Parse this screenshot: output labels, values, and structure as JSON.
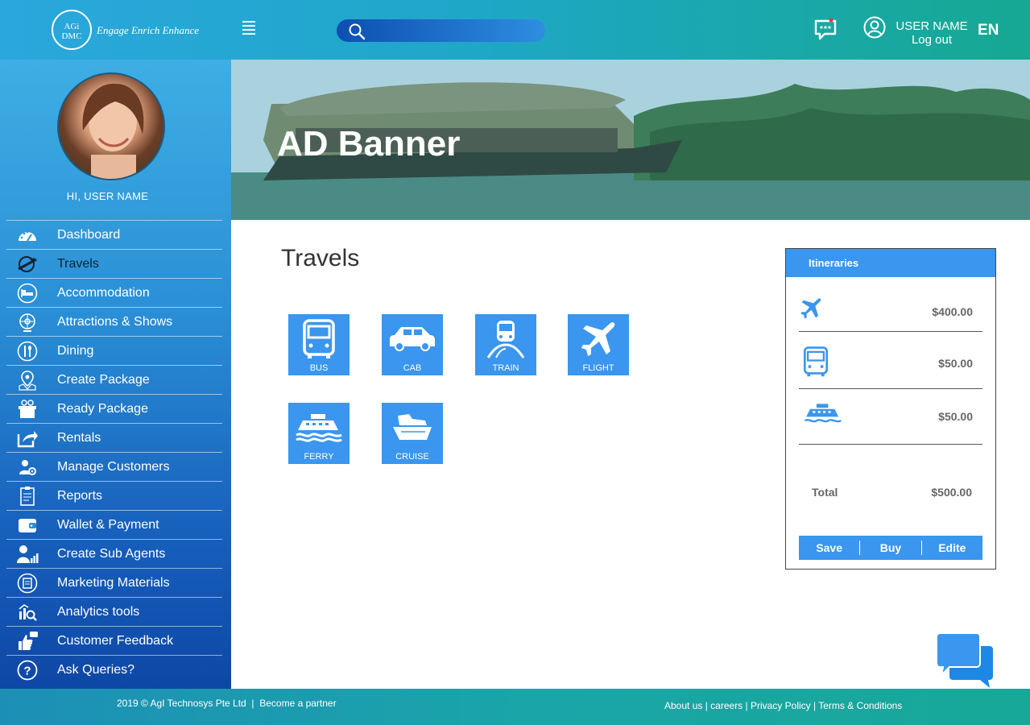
{
  "header": {
    "logo_text": "AGi DMC",
    "tagline": "Engage Enrich Enhance",
    "search_placeholder": "",
    "user_name": "USER NAME",
    "logout": "Log out",
    "language": "EN"
  },
  "sidebar": {
    "greeting": "HI, USER NAME",
    "items": [
      {
        "label": "Dashboard",
        "icon": "dashboard-icon"
      },
      {
        "label": "Travels",
        "icon": "travel-globe-icon"
      },
      {
        "label": "Accommodation",
        "icon": "bed-icon"
      },
      {
        "label": "Attractions & Shows",
        "icon": "ferris-wheel-icon"
      },
      {
        "label": "Dining",
        "icon": "dining-icon"
      },
      {
        "label": "Create Package",
        "icon": "map-pin-icon"
      },
      {
        "label": "Ready Package",
        "icon": "package-icon"
      },
      {
        "label": "Rentals",
        "icon": "share-icon"
      },
      {
        "label": "Manage Customers",
        "icon": "customer-gear-icon"
      },
      {
        "label": "Reports",
        "icon": "report-icon"
      },
      {
        "label": "Wallet & Payment",
        "icon": "wallet-icon"
      },
      {
        "label": "Create Sub Agents",
        "icon": "sub-agent-icon"
      },
      {
        "label": "Marketing Materials",
        "icon": "marketing-icon"
      },
      {
        "label": "Analytics tools",
        "icon": "analytics-icon"
      },
      {
        "label": "Customer Feedback",
        "icon": "feedback-icon"
      },
      {
        "label": "Ask Queries?",
        "icon": "question-icon"
      }
    ]
  },
  "banner": {
    "title": "AD Banner"
  },
  "main": {
    "title": "Travels",
    "tiles": [
      {
        "label": "BUS",
        "icon": "bus-icon"
      },
      {
        "label": "CAB",
        "icon": "cab-icon"
      },
      {
        "label": "TRAIN",
        "icon": "train-icon"
      },
      {
        "label": "FLIGHT",
        "icon": "flight-icon"
      },
      {
        "label": "FERRY",
        "icon": "ferry-icon"
      },
      {
        "label": "CRUISE",
        "icon": "cruise-icon"
      }
    ]
  },
  "itineraries": {
    "title": "Itineraries",
    "rows": [
      {
        "icon": "flight-icon",
        "price": "$400.00"
      },
      {
        "icon": "bus-icon",
        "price": "$50.00"
      },
      {
        "icon": "ferry-icon",
        "price": "$50.00"
      }
    ],
    "total_label": "Total",
    "total_value": "$500.00",
    "buttons": {
      "save": "Save",
      "buy": "Buy",
      "edit": "Edite"
    }
  },
  "footer": {
    "copyright": "2019 © AgI Technosys Pte Ltd",
    "partner": "Become a partner",
    "links": [
      "About us",
      "careers",
      "Privacy Policy",
      "Terms & Conditions"
    ]
  },
  "colors": {
    "accent": "#3a96ee",
    "header_start": "#2aa7dd",
    "header_end": "#16a892",
    "sidebar_top": "#3eaee4",
    "sidebar_bottom": "#0e47a6"
  }
}
